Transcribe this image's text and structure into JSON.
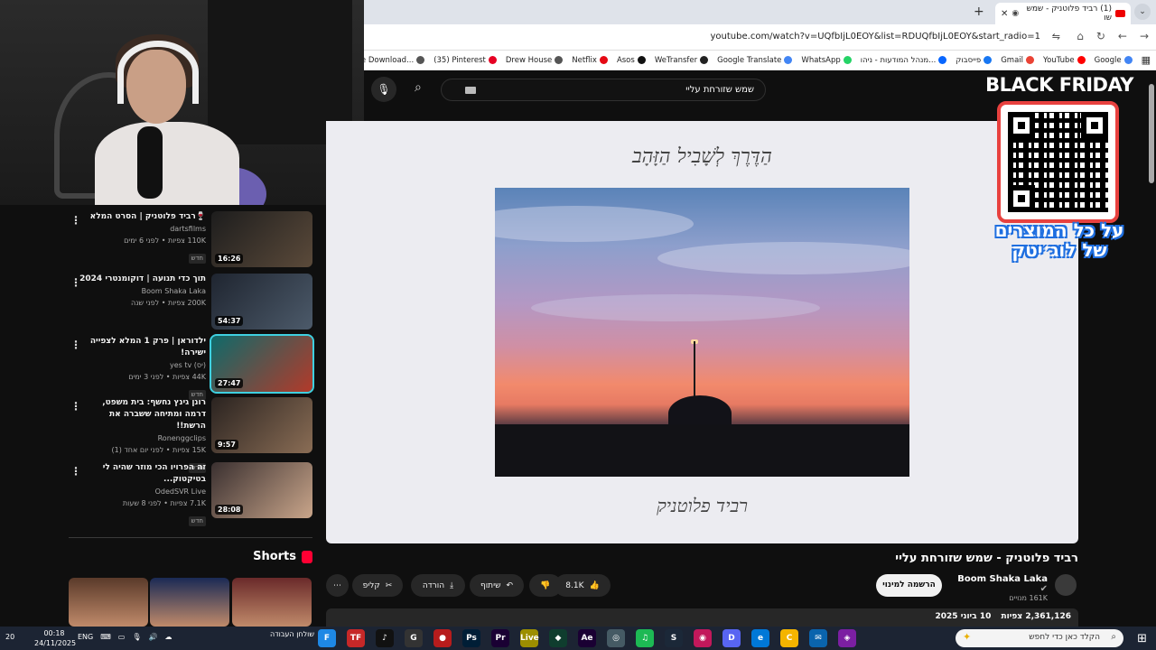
{
  "browser": {
    "tab_title": "(1) רביד פלוטניק - שמש שו",
    "new_tab": "+",
    "url": "youtube.com/watch?v=UQfbIjL0EOY&list=RDUQfbIjL0EOY&start_radio=1",
    "bookmarks": [
      {
        "label": "Google",
        "color": "#4285f4"
      },
      {
        "label": "YouTube",
        "color": "#ff0000"
      },
      {
        "label": "Gmail",
        "color": "#ea4335"
      },
      {
        "label": "פייסבוק",
        "color": "#1877f2"
      },
      {
        "label": "מנהל המודעות - ניהו...",
        "color": "#0866ff"
      },
      {
        "label": "WhatsApp",
        "color": "#25d366"
      },
      {
        "label": "Google Translate",
        "color": "#4285f4"
      },
      {
        "label": "WeTransfer",
        "color": "#222222"
      },
      {
        "label": "Asos",
        "color": "#111111"
      },
      {
        "label": "Netflix",
        "color": "#e50914"
      },
      {
        "label": "Drew House",
        "color": "#555555"
      },
      {
        "label": "(35) Pinterest",
        "color": "#e60023"
      },
      {
        "label": "uTube Download...",
        "color": "#555555"
      }
    ]
  },
  "search": {
    "query": "שמש שזורחת עליי"
  },
  "player": {
    "title_art": "הַדֶּרֶךְ לְשָׁבִיל הַזָּהָב",
    "signature": "רביד פלוטניק"
  },
  "promo": {
    "headline": "BLACK FRIDAY",
    "text": "על כל המוצרים של לוג׳יטק"
  },
  "recommendations": [
    {
      "title": "🍷רביד פלוטניק | הסרט המלא",
      "channel": "dartsfilms",
      "meta": "110K צפיות • לפני 6 ימים",
      "badge": "חדש",
      "duration": "16:26",
      "thumb": [
        "#1d1d1d",
        "#5b4a3a"
      ]
    },
    {
      "title": "תוך כדי תנועה | דוקומנטרי 2024",
      "channel": "Boom Shaka Laka",
      "meta": "200K צפיות • לפני שנה",
      "badge": "",
      "duration": "54:37",
      "thumb": [
        "#1f2530",
        "#4c5a6a"
      ]
    },
    {
      "title": "ילדוראן | פרק 1 המלא לצפייה ישירה!",
      "channel": "(יס) yes tv",
      "meta": "44K צפיות • לפני 3 ימים",
      "badge": "חדש",
      "duration": "27:47",
      "thumb": [
        "#0e6a6a",
        "#b33a2a"
      ]
    },
    {
      "title": "רונן גינץ נחשף: בית משפט, דרמה ומתיחה ששברה את הרשת!!",
      "channel": "Ronenggclips",
      "meta": "15K צפיות • לפני יום אחד (1)",
      "badge": "חדש",
      "duration": "9:57",
      "thumb": [
        "#2a2320",
        "#8a6d55"
      ]
    },
    {
      "title": "זה הפרויו הכי מוזר שהיה לי בטיקטוק...",
      "channel": "OdedSVR Live",
      "meta": "7.1K צפיות • לפני 8 שעות",
      "badge": "חדש",
      "duration": "28:08",
      "thumb": [
        "#3a3030",
        "#c9a58a"
      ]
    }
  ],
  "shorts": {
    "label": "Shorts",
    "thumbs": [
      "#5a3a2a",
      "#1a2a55",
      "#6a2a2a"
    ]
  },
  "video": {
    "title": "רביד פלוטניק - שמש שזורחת עליי",
    "channel": "Boom Shaka Laka",
    "subscribers": "161K מנויים",
    "subscribe_label": "הרשמה למינוי",
    "likes": "8.1K",
    "share_label": "שיתוף",
    "download_label": "הורדה",
    "clip_label": "קליפ",
    "views": "2,361,126 צפיות",
    "date": "10 ביוני 2025"
  },
  "taskbar": {
    "search_placeholder": "הקלד כאן כדי לחפש",
    "widget": "שולחן העבודה",
    "lang": "ENG",
    "time": "00:18",
    "date": "24/11/2025",
    "temp": "20",
    "apps": [
      {
        "label": "F",
        "color": "#1e88e5"
      },
      {
        "label": "TF",
        "color": "#c62828"
      },
      {
        "label": "♪",
        "color": "#111111"
      },
      {
        "label": "G",
        "color": "#333333"
      },
      {
        "label": "●",
        "color": "#b71c1c"
      },
      {
        "label": "Ps",
        "color": "#001e36"
      },
      {
        "label": "Pr",
        "color": "#1a0033"
      },
      {
        "label": "Live",
        "color": "#9c8e00"
      },
      {
        "label": "◆",
        "color": "#0f3d2e"
      },
      {
        "label": "Ae",
        "color": "#1a0033"
      },
      {
        "label": "◎",
        "color": "#455a64"
      },
      {
        "label": "♫",
        "color": "#1db954"
      },
      {
        "label": "S",
        "color": "#1b2838"
      },
      {
        "label": "◉",
        "color": "#c2185b"
      },
      {
        "label": "D",
        "color": "#5865f2"
      },
      {
        "label": "e",
        "color": "#0078d7"
      },
      {
        "label": "C",
        "color": "#f4b400"
      },
      {
        "label": "✉",
        "color": "#0a64ad"
      },
      {
        "label": "◈",
        "color": "#7b1fa2"
      }
    ]
  }
}
